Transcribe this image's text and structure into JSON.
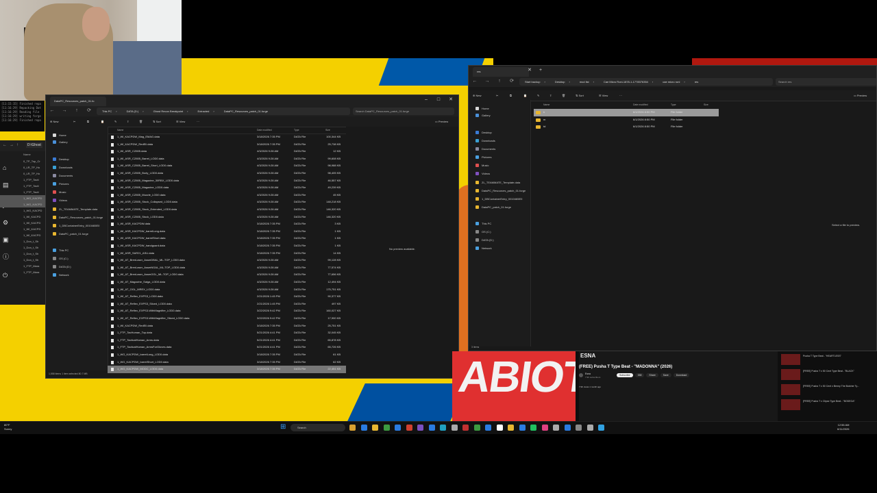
{
  "terminal_lines": [
    "[11:15:15] Finished repa",
    "[11:16:29] Repacking Dat",
    "[11:16:29] Reading file",
    "[11:16:29] writing forge",
    "[11:16:29] Finished repa"
  ],
  "left_explorer": {
    "address": "D:\\Ghost",
    "col_name": "Name",
    "items": [
      "0_TP_Top_Cr",
      "0_LR_TP_Ho",
      "0_LR_TP_Ho",
      "1_FTP_Tacti",
      "1_FTP_Tacti",
      "1_FTP_Tacti",
      "1_WG_KACPD",
      "1_WG_KACPD",
      "1_WG_KACPD",
      "1_WI_KACPD",
      "1_WI_KACPD",
      "1_WI_KACPD",
      "1_WI_KACPD",
      "1_Don_t_Sh",
      "1_Don_t_Sh",
      "1_Don_t_Sh",
      "1_Don_t_Sh",
      "1_FTP_Mara",
      "1_FTP_Mara"
    ]
  },
  "main_explorer": {
    "tab_title": "DataPC_Resources_patch_01.fo",
    "breadcrumbs": [
      "This PC",
      "DATA (D:)",
      "Ghost Recon Breakpoint",
      "Extracted",
      "DataPC_Resources_patch_01.forge"
    ],
    "search_placeholder": "Search DataPC_Resources_patch_01.forge",
    "commands": {
      "new": "New",
      "sort": "Sort",
      "view": "View",
      "preview": "Preview"
    },
    "nav": [
      {
        "label": "Home",
        "color": "#d8d8d8"
      },
      {
        "label": "Gallery",
        "color": "#4a90d9"
      },
      {
        "label": "Desktop",
        "color": "#3a7bd5"
      },
      {
        "label": "Downloads",
        "color": "#3aa0d5"
      },
      {
        "label": "Documents",
        "color": "#8a8aa0"
      },
      {
        "label": "Pictures",
        "color": "#4aa0e0"
      },
      {
        "label": "Music",
        "color": "#e05050"
      },
      {
        "label": "Videos",
        "color": "#8050c0"
      },
      {
        "label": "ZL_TEAMMATE_Template.data",
        "color": "#e8b630"
      },
      {
        "label": "DataPC_Resources_patch_01.forge",
        "color": "#e8b630"
      },
      {
        "label": "1_DBContainerEntry_0010465E0",
        "color": "#e8b630"
      },
      {
        "label": "DataPC_patch_01.forge",
        "color": "#e8b630"
      },
      {
        "label": "This PC",
        "color": "#4aa0e0"
      },
      {
        "label": "OS (C:)",
        "color": "#888"
      },
      {
        "label": "DATA (D:)",
        "color": "#888"
      },
      {
        "label": "Network",
        "color": "#4aa0e0"
      }
    ],
    "columns": {
      "name": "Name",
      "date": "Date modified",
      "type": "Type",
      "size": "Size"
    },
    "files": [
      {
        "name": "1_WI_KACPDW_Mag_EMAG.data",
        "date": "3/18/2026 7:35 PM",
        "type": "DATA File",
        "size": "100,344 KB"
      },
      {
        "name": "1_WI_KACPDW_RedEll.data",
        "date": "3/18/2026 7:35 PM",
        "type": "DATA File",
        "size": "25,738 KB"
      },
      {
        "name": "1_WI_ASR_CZ805.data",
        "date": "4/3/2026 9:28 AM",
        "type": "DATA File",
        "size": "12 KB"
      },
      {
        "name": "1_WI_ASR_CZ805_Barrel_LOD0.data",
        "date": "4/3/2026 9:28 AM",
        "type": "DATA File",
        "size": "99,608 KB"
      },
      {
        "name": "1_WI_ASR_CZ805_Barrel_Short_LOD0.data",
        "date": "4/3/2026 9:28 AM",
        "type": "DATA File",
        "size": "98,988 KB"
      },
      {
        "name": "1_WI_ASR_CZ805_Body_LOD0.data",
        "date": "4/3/2026 9:28 AM",
        "type": "DATA File",
        "size": "98,405 KB"
      },
      {
        "name": "1_WI_ASR_CZ805_Magazine_30RBX_LOD0.data",
        "date": "4/3/2026 9:28 AM",
        "type": "DATA File",
        "size": "46,557 KB"
      },
      {
        "name": "1_WI_ASR_CZ805_Magazine_LOD0.data",
        "date": "4/3/2026 9:28 AM",
        "type": "DATA File",
        "size": "49,239 KB"
      },
      {
        "name": "1_WI_ASR_CZ805_Muzzle_LOD0.data",
        "date": "4/3/2026 9:28 AM",
        "type": "DATA File",
        "size": "45 KB"
      },
      {
        "name": "1_WI_ASR_CZ805_Stock_Collapsed_LOD0.data",
        "date": "4/3/2026 9:28 AM",
        "type": "DATA File",
        "size": "148,218 KB"
      },
      {
        "name": "1_WI_ASR_CZ805_Stock_Extended_LOD0.data",
        "date": "4/3/2026 9:28 AM",
        "type": "DATA File",
        "size": "146,320 KB"
      },
      {
        "name": "1_WI_ASR_CZ805_Stock_LOD0.data",
        "date": "4/3/2026 9:28 AM",
        "type": "DATA File",
        "size": "146,320 KB"
      },
      {
        "name": "1_WI_ASR_KACPDW.data",
        "date": "3/18/2026 7:35 PM",
        "type": "DATA File",
        "size": "3 KB"
      },
      {
        "name": "1_WI_ASR_KACPDW_barrelLong.data",
        "date": "3/18/2026 7:35 PM",
        "type": "DATA File",
        "size": "1 KB"
      },
      {
        "name": "1_WI_ASR_KACPDW_barrelShort.data",
        "date": "3/18/2026 7:35 PM",
        "type": "DATA File",
        "size": "1 KB"
      },
      {
        "name": "1_WI_ASR_KACPDW_handguard.data",
        "date": "3/18/2026 7:35 PM",
        "type": "DATA File",
        "size": "1 KB"
      },
      {
        "name": "1_WI_ASR_SAR21_ASU.data",
        "date": "3/18/2026 7:35 PM",
        "type": "DATA File",
        "size": "14 KB"
      },
      {
        "name": "1_WI_AT_BrenLaser_AssmDBAL_ML-TOP_LOD0.data",
        "date": "4/3/2026 9:28 AM",
        "type": "DATA File",
        "size": "99,128 KB"
      },
      {
        "name": "1_WI_AT_BrenLaser_AssmNGAL_ML-TOP_LOD0.data",
        "date": "4/3/2026 9:28 AM",
        "type": "DATA File",
        "size": "77,574 KB"
      },
      {
        "name": "1_WI_AT_BrenLaser_AssmOGL_ML-TOP_LOD0.data",
        "date": "4/3/2026 9:28 AM",
        "type": "DATA File",
        "size": "77,656 KB"
      },
      {
        "name": "1_WI_AT_Magazine_Saiga_LOD0.data",
        "date": "4/3/2026 9:28 AM",
        "type": "DATA File",
        "size": "12,494 KB"
      },
      {
        "name": "1_WI_AT_OGL_MREX_LOD0.data",
        "date": "4/3/2026 9:28 AM",
        "type": "DATA File",
        "size": "175,751 KB"
      },
      {
        "name": "1_WI_AT_Reflex_EXPS3_LOD0.data",
        "date": "2/21/2026 1:45 PM",
        "type": "DATA File",
        "size": "90,377 KB"
      },
      {
        "name": "1_WI_AT_Reflex_EXPS3_Sliced_LOD0.data",
        "date": "2/21/2026 1:45 PM",
        "type": "DATA File",
        "size": "497 KB"
      },
      {
        "name": "1_WI_AT_Reflex_EXPS3-WithMagnifier_LOD0.data",
        "date": "3/22/2026 9:42 PM",
        "type": "DATA File",
        "size": "160,027 KB"
      },
      {
        "name": "1_WI_AT_Reflex_EXPS3-WithMagnifier_Sliced_LOD0.data",
        "date": "3/22/2026 9:42 PM",
        "type": "DATA File",
        "size": "17,900 KB"
      },
      {
        "name": "1_WI_KACPDW_RedEll.data",
        "date": "3/18/2026 7:35 PM",
        "type": "DATA File",
        "size": "25,751 KB"
      },
      {
        "name": "1_FTP_TacHuman_Top.data",
        "date": "5/21/2026 4:41 PM",
        "type": "DATA File",
        "size": "32,045 KB"
      },
      {
        "name": "1_FTP_TacticalHuman_Arms.data",
        "date": "5/21/2026 4:41 PM",
        "type": "DATA File",
        "size": "65,878 KB"
      },
      {
        "name": "1_FTP_TacticalHuman_ArmsForGloves.data",
        "date": "5/21/2026 4:41 PM",
        "type": "DATA File",
        "size": "65,726 KB"
      },
      {
        "name": "1_WG_KACPDW_barrelLong_LOD0.data",
        "date": "3/18/2026 7:35 PM",
        "type": "DATA File",
        "size": "61 KB"
      },
      {
        "name": "1_WG_KACPDW_barrelShort_LOD0.data",
        "date": "3/18/2026 7:35 PM",
        "type": "DATA File",
        "size": "62 KB"
      },
      {
        "name": "1_WG_KACPDW_MODC_LOD0.data",
        "date": "3/18/2026 7:35 PM",
        "type": "DATA File",
        "size": "22,451 KB"
      }
    ],
    "preview_msg": "No preview available.",
    "status": "1,558 items   1 item selected  80.7 MB"
  },
  "right_explorer": {
    "tab_title": "res",
    "breadcrumbs": [
      "Start backup",
      "Desktop",
      "mod list",
      "Cae Micro Roni-1878-1-1778376354",
      "cae micro roni",
      "res"
    ],
    "search_placeholder": "Search res",
    "commands": {
      "new": "New",
      "sort": "Sort",
      "view": "View",
      "preview": "Preview"
    },
    "nav": [
      {
        "label": "Home",
        "color": "#d8d8d8"
      },
      {
        "label": "Gallery",
        "color": "#4a90d9"
      },
      {
        "label": "Desktop",
        "color": "#3a7bd5"
      },
      {
        "label": "Downloads",
        "color": "#3aa0d5"
      },
      {
        "label": "Documents",
        "color": "#8a8aa0"
      },
      {
        "label": "Pictures",
        "color": "#4aa0e0"
      },
      {
        "label": "Music",
        "color": "#e05050"
      },
      {
        "label": "Videos",
        "color": "#8050c0"
      },
      {
        "label": "ZL_TEAMMATE_Template.data",
        "color": "#e8b630"
      },
      {
        "label": "DataPC_Resources_patch_01.forge",
        "color": "#e8b630"
      },
      {
        "label": "1_DBContainerEntry_0010465E0",
        "color": "#e8b630"
      },
      {
        "label": "DataPC_patch_01.forge",
        "color": "#e8b630"
      },
      {
        "label": "This PC",
        "color": "#4aa0e0"
      },
      {
        "label": "OS (C:)",
        "color": "#888"
      },
      {
        "label": "DATA (D:)",
        "color": "#888"
      },
      {
        "label": "Network",
        "color": "#4aa0e0"
      }
    ],
    "columns": {
      "name": "Name",
      "date": "Date modified",
      "type": "Type",
      "size": "Size"
    },
    "folders": [
      {
        "name": "b",
        "date": "6/1/2026 8:50 PM",
        "type": "File folder"
      },
      {
        "name": "m",
        "date": "6/1/2026 8:50 PM",
        "type": "File folder"
      },
      {
        "name": "td",
        "date": "6/1/2026 8:50 PM",
        "type": "File folder"
      }
    ],
    "preview_msg": "Select a file to preview.",
    "status": "3 items"
  },
  "youtube": {
    "thumb_text": "ABIOT",
    "title": "(FREE) Pusha T Type Beat - \"MADONNA\" (2026)",
    "channel": "Esna",
    "sub_count": "7.9K subscribers",
    "views": "7.9K views  1 month ago",
    "buttons": [
      "Subscribe",
      "338",
      "Share",
      "Save",
      "Download"
    ],
    "suggestions": [
      "Pusha T Type Beat - \"HEARTLESS\"",
      "[FREE] Pusha T x 50 Cent Type Beat - \"BLACK\"",
      "[FREE] Pusha T x 50 Cent x Benny The Butcher Ty...",
      "[FREE] Pusha T x Clipse Type Beat - \"BODEGA\""
    ]
  },
  "taskbar": {
    "weather_temp": "80°F",
    "weather_desc": "Sunny",
    "search": "Search",
    "time": "12:56 AM",
    "date": "6/11/2026"
  }
}
